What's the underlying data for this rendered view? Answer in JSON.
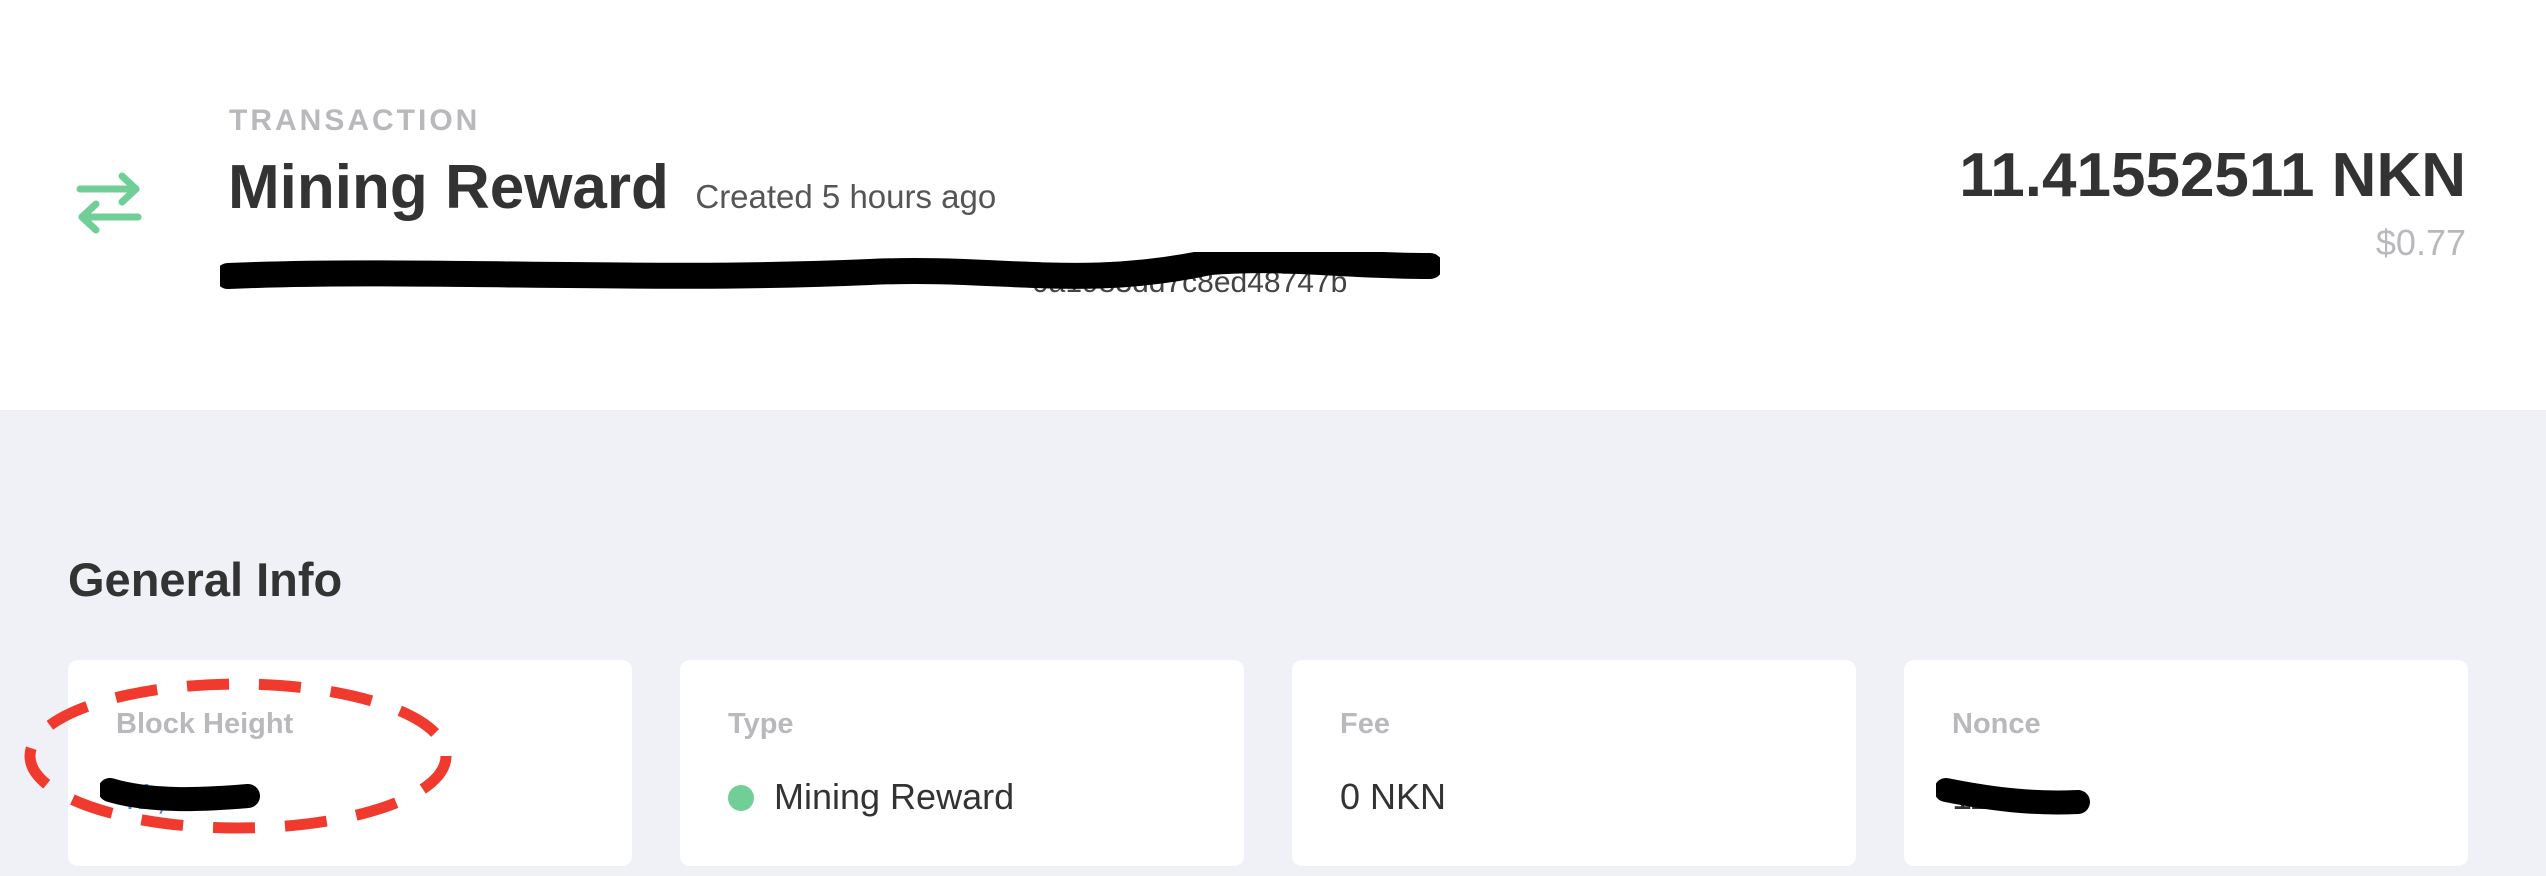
{
  "header": {
    "eyebrow": "TRANSACTION",
    "title": "Mining Reward",
    "created": "Created 5 hours ago",
    "hash_visible": "0a1983dd7c8ed48747b",
    "amount": "11.41552511 NKN",
    "usd": "$0.77"
  },
  "section": {
    "title": "General Info"
  },
  "cards": [
    {
      "label": "Block Height",
      "value": "41,"
    },
    {
      "label": "Type",
      "value": "Mining Reward"
    },
    {
      "label": "Fee",
      "value": "0 NKN"
    },
    {
      "label": "Nonce",
      "value": "11"
    }
  ],
  "colors": {
    "accent": "#6fcf97",
    "link": "#3b8fe0",
    "highlight": "#f03a2e",
    "redaction": "#000000"
  },
  "icons": {
    "transaction": "swap-arrows-icon"
  }
}
